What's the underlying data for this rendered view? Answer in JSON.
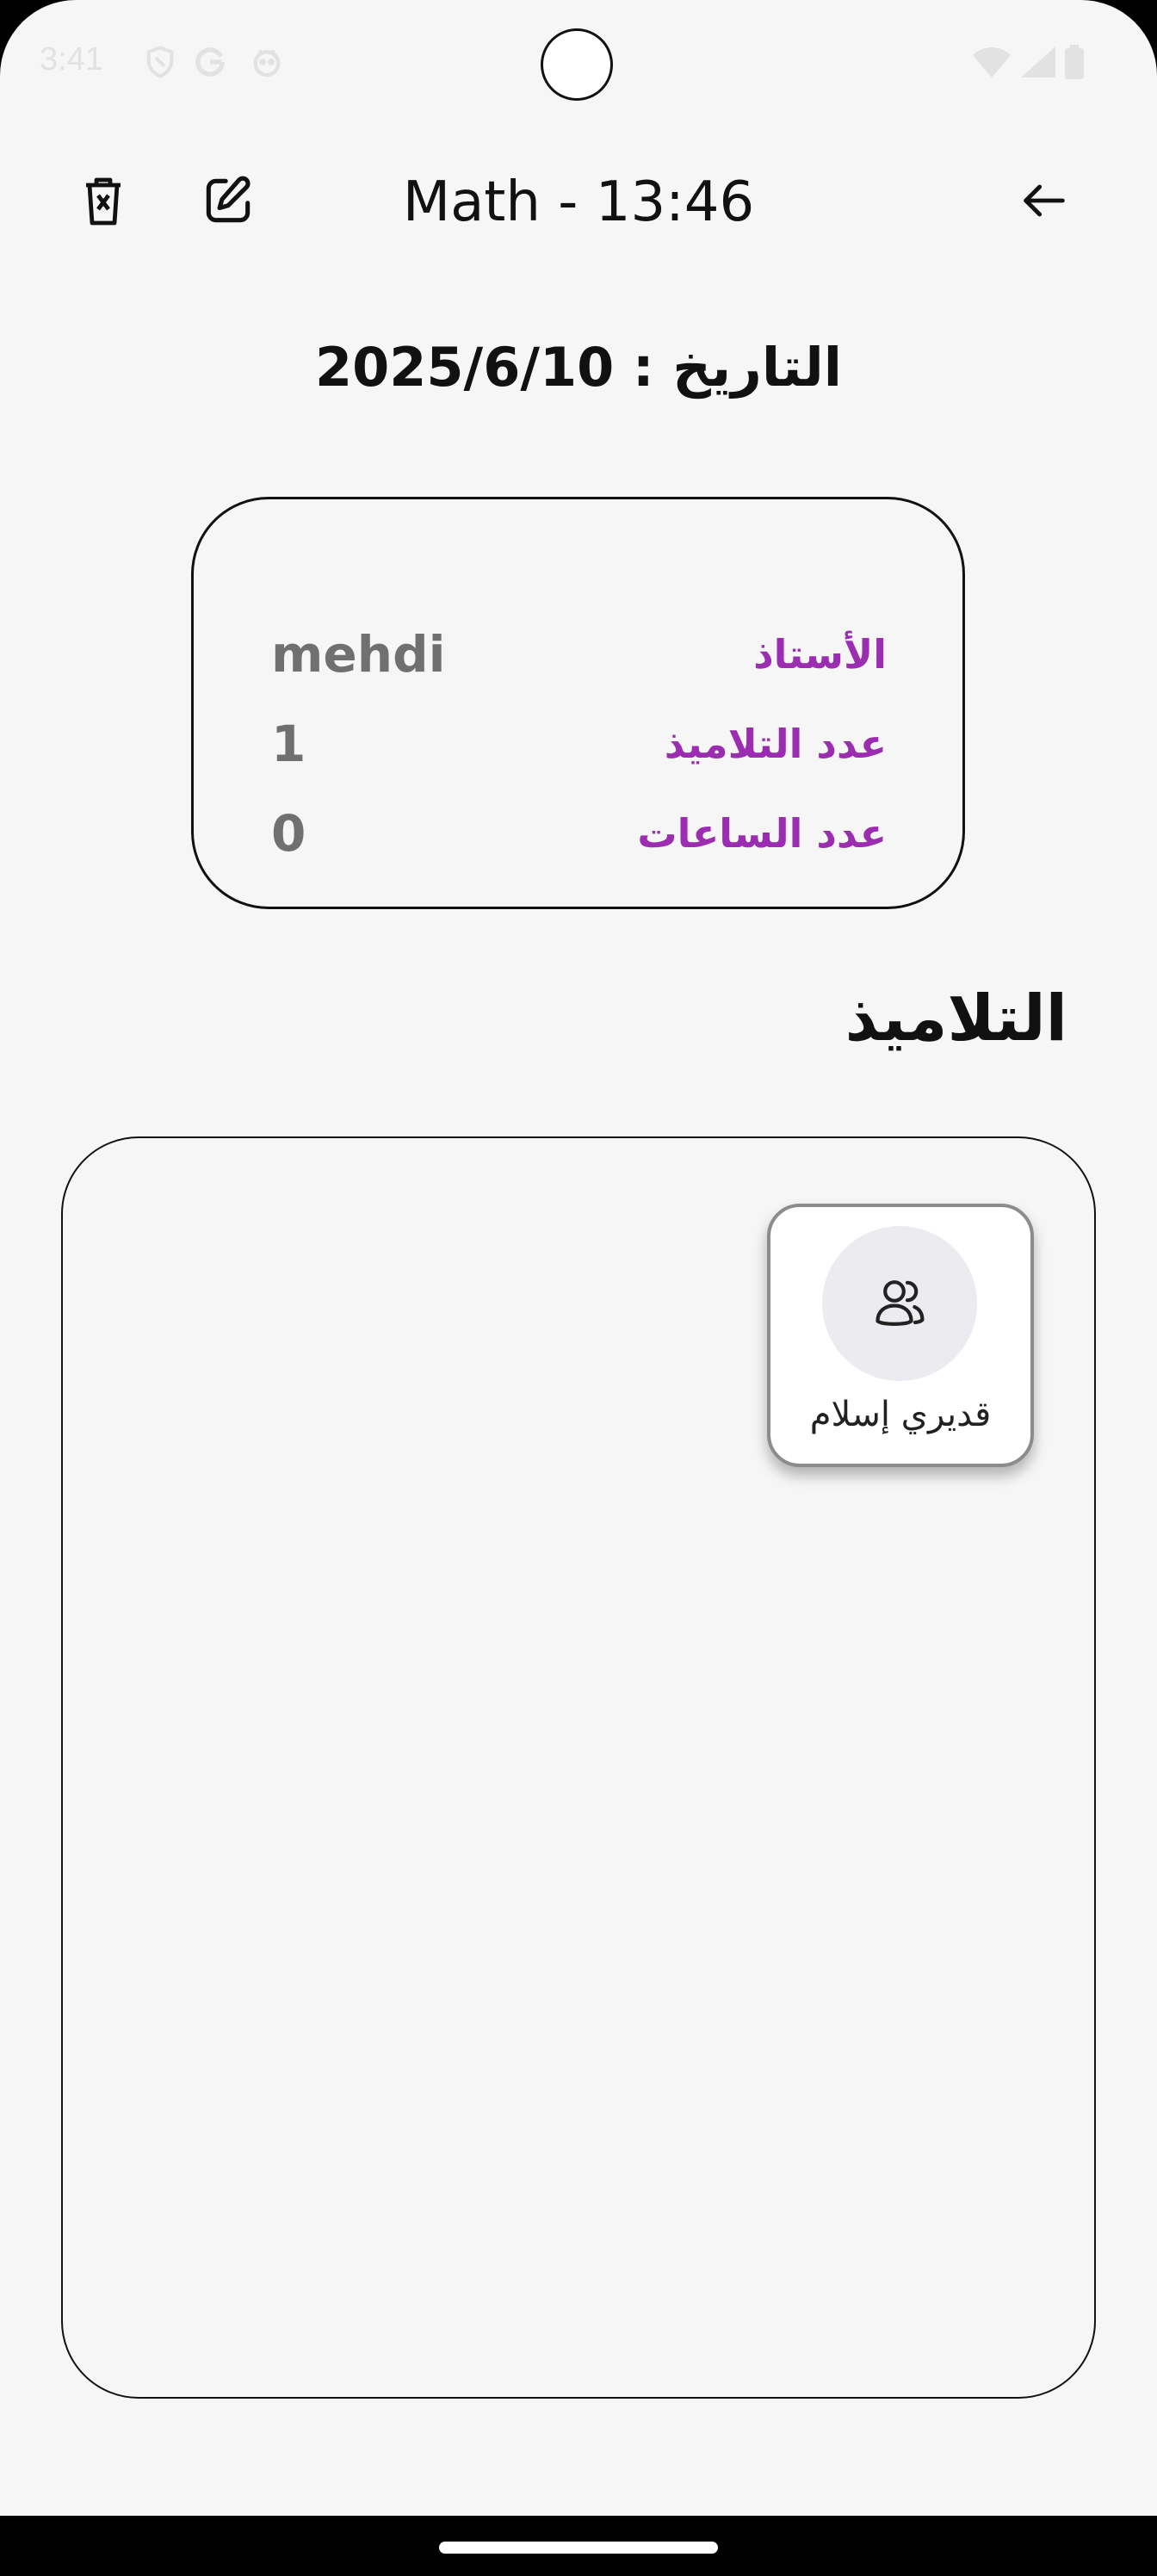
{
  "status_bar": {
    "time": "3:41",
    "icons": [
      "shield-icon",
      "google-icon",
      "android-icon",
      "wifi-icon",
      "signal-icon",
      "battery-icon"
    ]
  },
  "app_bar": {
    "title": "Math - 13:46",
    "icons": [
      "delete-icon",
      "edit-icon",
      "back-arrow-icon"
    ]
  },
  "date_line": "2025/6/10 : التاريخ",
  "info_card": {
    "rows": [
      {
        "label": "الأستاذ",
        "value": "mehdi"
      },
      {
        "label": "عدد التلاميذ",
        "value": "1"
      },
      {
        "label": "عدد الساعات",
        "value": "0"
      }
    ]
  },
  "students_section": {
    "title": "التلاميذ",
    "students": [
      {
        "name": "قديري إسلام",
        "icon": "users-icon"
      }
    ]
  },
  "colors": {
    "background": "#f6f6f6",
    "label_purple": "#9a2db0",
    "value_gray": "#707070",
    "text_dark": "#111111"
  }
}
